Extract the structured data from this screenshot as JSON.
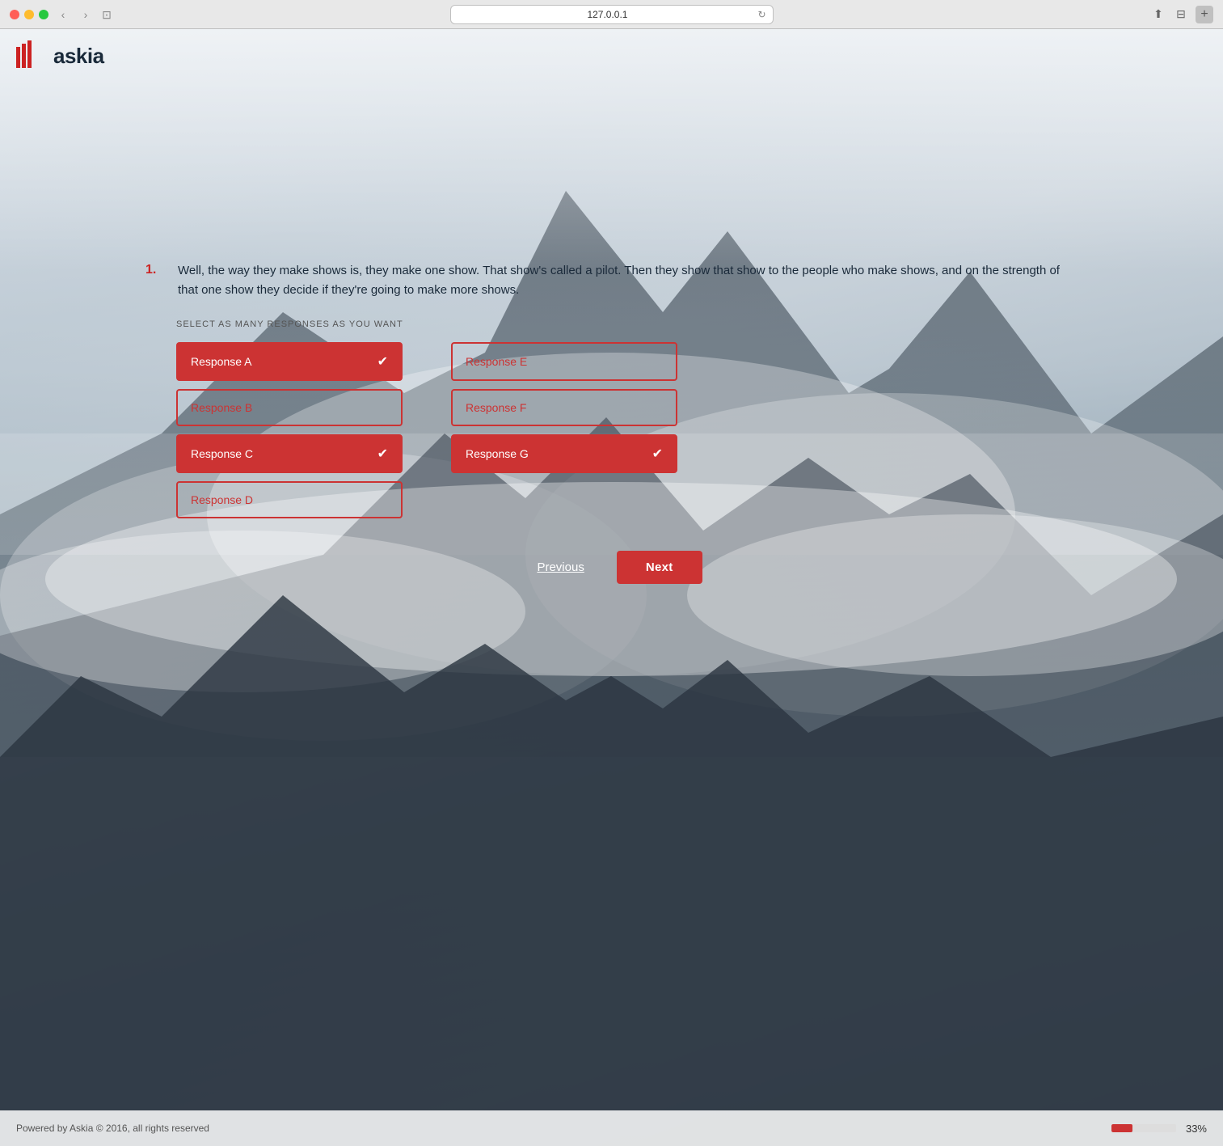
{
  "browser": {
    "url": "127.0.0.1",
    "traffic_lights": [
      "red",
      "yellow",
      "green"
    ]
  },
  "logo": {
    "text": "askia"
  },
  "question": {
    "number": "1.",
    "text": "Well, the way they make shows is, they make one show. That show's called a pilot. Then they show that show to the people who make shows, and on the strength of that one show they decide if they're going to make more shows.",
    "instruction": "SELECT AS MANY RESPONSES AS YOU WANT",
    "responses": [
      {
        "id": "A",
        "label": "Response A",
        "selected": true
      },
      {
        "id": "B",
        "label": "Response B",
        "selected": false
      },
      {
        "id": "C",
        "label": "Response C",
        "selected": true
      },
      {
        "id": "D",
        "label": "Response D",
        "selected": false
      },
      {
        "id": "E",
        "label": "Response E",
        "selected": false
      },
      {
        "id": "F",
        "label": "Response F",
        "selected": false
      },
      {
        "id": "G",
        "label": "Response G",
        "selected": true
      }
    ]
  },
  "navigation": {
    "previous_label": "Previous",
    "next_label": "Next"
  },
  "footer": {
    "copyright": "Powered by Askia © 2016, all rights reserved",
    "progress_percent": "33%",
    "progress_value": 33
  }
}
